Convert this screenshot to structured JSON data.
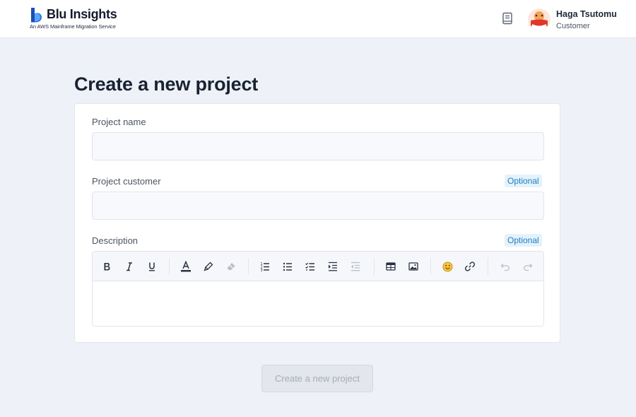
{
  "header": {
    "brand_name": "Blu Insights",
    "brand_tagline": "An AWS Mainframe Migration Service",
    "brand_color": "#2f6fe0",
    "docs_icon": "book-icon",
    "user": {
      "name": "Haga Tsutomu",
      "role": "Customer"
    }
  },
  "main": {
    "title": "Create a new project",
    "fields": {
      "project_name": {
        "label": "Project name",
        "value": "",
        "placeholder": ""
      },
      "project_customer": {
        "label": "Project customer",
        "badge": "Optional",
        "value": "",
        "placeholder": ""
      },
      "description": {
        "label": "Description",
        "badge": "Optional",
        "value": ""
      }
    },
    "toolbar_icons": [
      "bold-icon",
      "italic-icon",
      "underline-icon",
      "text-color-icon",
      "highlight-icon",
      "clear-format-icon",
      "ordered-list-icon",
      "bullet-list-icon",
      "checklist-icon",
      "indent-icon",
      "outdent-icon",
      "table-icon",
      "image-icon",
      "emoji-icon",
      "link-icon",
      "undo-icon",
      "redo-icon"
    ],
    "submit_label": "Create a new project"
  },
  "colors": {
    "page_background": "#eef2f8",
    "badge_text": "#1f7fbf",
    "badge_background": "#e4f2fb",
    "button_disabled_bg": "#e3e6eb",
    "button_disabled_text": "#a7adb7"
  }
}
